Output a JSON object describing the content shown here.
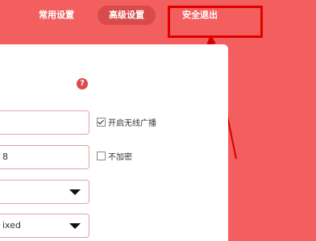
{
  "nav": {
    "common": "常用设置",
    "advanced": "高级设置",
    "logout": "安全退出"
  },
  "form": {
    "help": "?",
    "ssid_value": "",
    "password_value": "8",
    "broadcast_label": "开启无线广播",
    "broadcast_checked": true,
    "noencrypt_label": "不加密",
    "noencrypt_checked": false,
    "select1_value": "",
    "select2_value": "ixed"
  },
  "colors": {
    "header_bg": "#f35e5e",
    "active_tab": "#d94a4a",
    "annotation": "#e00000"
  }
}
